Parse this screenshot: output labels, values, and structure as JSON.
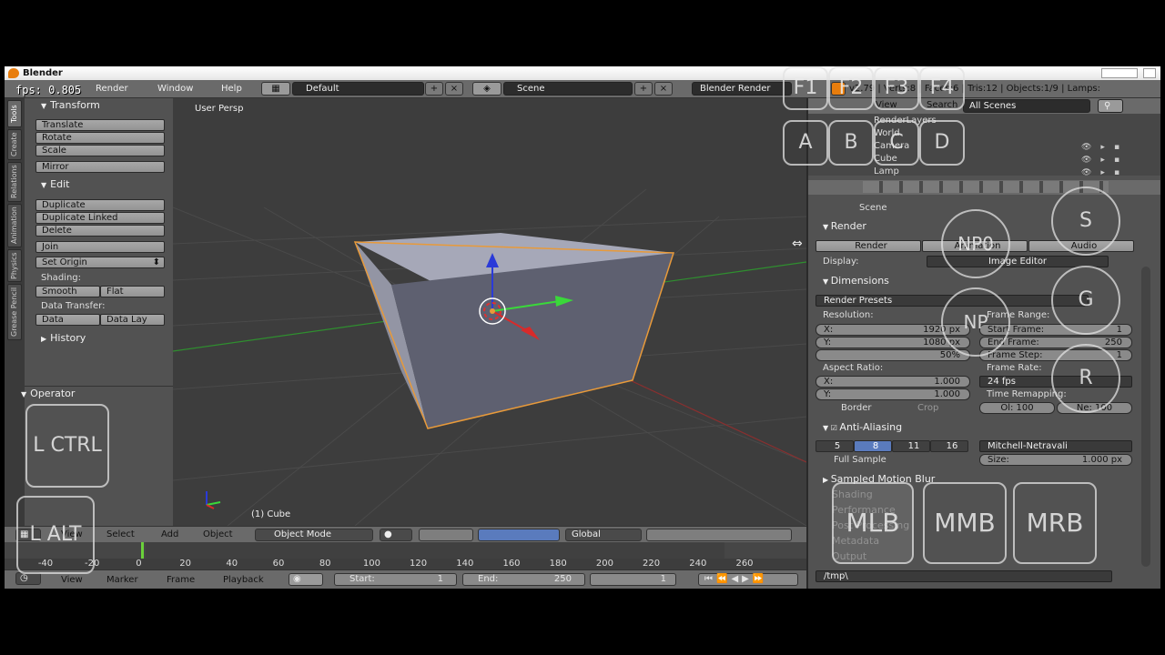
{
  "app": {
    "title": "Blender",
    "fps": "fps: 0.805"
  },
  "infobar": {
    "menus": [
      "Render",
      "Window",
      "Help"
    ],
    "layout": "Default",
    "scene": "Scene",
    "engine": "Blender Render",
    "stats": "v2.79 | Verts:8 | Faces:6 | Tris:12 | Objects:1/9 | Lamps:"
  },
  "tabs": [
    "Tools",
    "Create",
    "Relations",
    "Animation",
    "Physics",
    "Grease Pencil"
  ],
  "shelf": {
    "transform": {
      "title": "Transform",
      "buttons": [
        "Translate",
        "Rotate",
        "Scale"
      ],
      "mirror": "Mirror"
    },
    "edit": {
      "title": "Edit",
      "buttons": [
        "Duplicate",
        "Duplicate Linked",
        "Delete"
      ],
      "join": "Join",
      "set_origin": "Set Origin",
      "shading_label": "Shading:",
      "smooth": "Smooth",
      "flat": "Flat",
      "transfer_label": "Data Transfer:",
      "data": "Data",
      "data_lay": "Data Lay"
    },
    "history": "History",
    "operator": "Operator"
  },
  "viewport": {
    "mode_label": "User Persp",
    "object_label": "(1) Cube"
  },
  "view3d_header": {
    "menus": [
      "View",
      "Select",
      "Add",
      "Object"
    ],
    "mode": "Object Mode",
    "orientation": "Global"
  },
  "timeline": {
    "ticks": [
      "-40",
      "-20",
      "0",
      "20",
      "40",
      "60",
      "80",
      "100",
      "120",
      "140",
      "160",
      "180",
      "200",
      "220",
      "240",
      "260"
    ],
    "menus": [
      "View",
      "Marker",
      "Frame",
      "Playback"
    ],
    "start_label": "Start:",
    "start": "1",
    "end_label": "End:",
    "end": "250",
    "current": "1"
  },
  "outliner": {
    "menus": [
      "View",
      "Search"
    ],
    "filter": "All Scenes",
    "items": [
      "RenderLayers",
      "World",
      "Camera",
      "Cube",
      "Lamp"
    ]
  },
  "properties": {
    "breadcrumb": "Scene",
    "render": {
      "title": "Render",
      "render": "Render",
      "animation": "Animation",
      "audio": "Audio",
      "display_label": "Display:",
      "display": "Image Editor"
    },
    "dimensions": {
      "title": "Dimensions",
      "presets": "Render Presets",
      "resolution_label": "Resolution:",
      "x_label": "X:",
      "x": "1920 px",
      "y_label": "Y:",
      "y": "1080 px",
      "pct": "50%",
      "frame_range_label": "Frame Range:",
      "start_label": "Start Frame:",
      "start": "1",
      "end_label": "End Frame:",
      "end": "250",
      "step_label": "Frame Step:",
      "step": "1",
      "aspect_label": "Aspect Ratio:",
      "ax_label": "X:",
      "ax": "1.000",
      "ay_label": "Y:",
      "ay": "1.000",
      "frame_rate_label": "Frame Rate:",
      "frame_rate": "24 fps",
      "border": "Border",
      "crop": "Crop",
      "remap_label": "Time Remapping:",
      "old": "Ol: 100",
      "new": "Ne: 100"
    },
    "aa": {
      "title": "Anti-Aliasing",
      "samples": [
        "5",
        "8",
        "11",
        "16"
      ],
      "active_sample": "8",
      "filter": "Mitchell-Netravali",
      "full_sample": "Full Sample",
      "size": "Size:",
      "size_val": "1.000 px"
    },
    "collapsed": [
      "Sampled Motion Blur",
      "Shading",
      "Performance",
      "Post Processing",
      "Metadata",
      "Output"
    ],
    "output_path": "/tmp\\"
  },
  "overlay": {
    "fkeys": [
      "F1",
      "F2",
      "F3",
      "F4"
    ],
    "letters": [
      "A",
      "B",
      "C",
      "D"
    ],
    "circles": [
      "NP0",
      "NP",
      "S",
      "G",
      "R"
    ],
    "l_ctrl": "L CTRL",
    "l_alt": "L ALT",
    "mouse": [
      "MLB",
      "MMB",
      "MRB"
    ]
  }
}
